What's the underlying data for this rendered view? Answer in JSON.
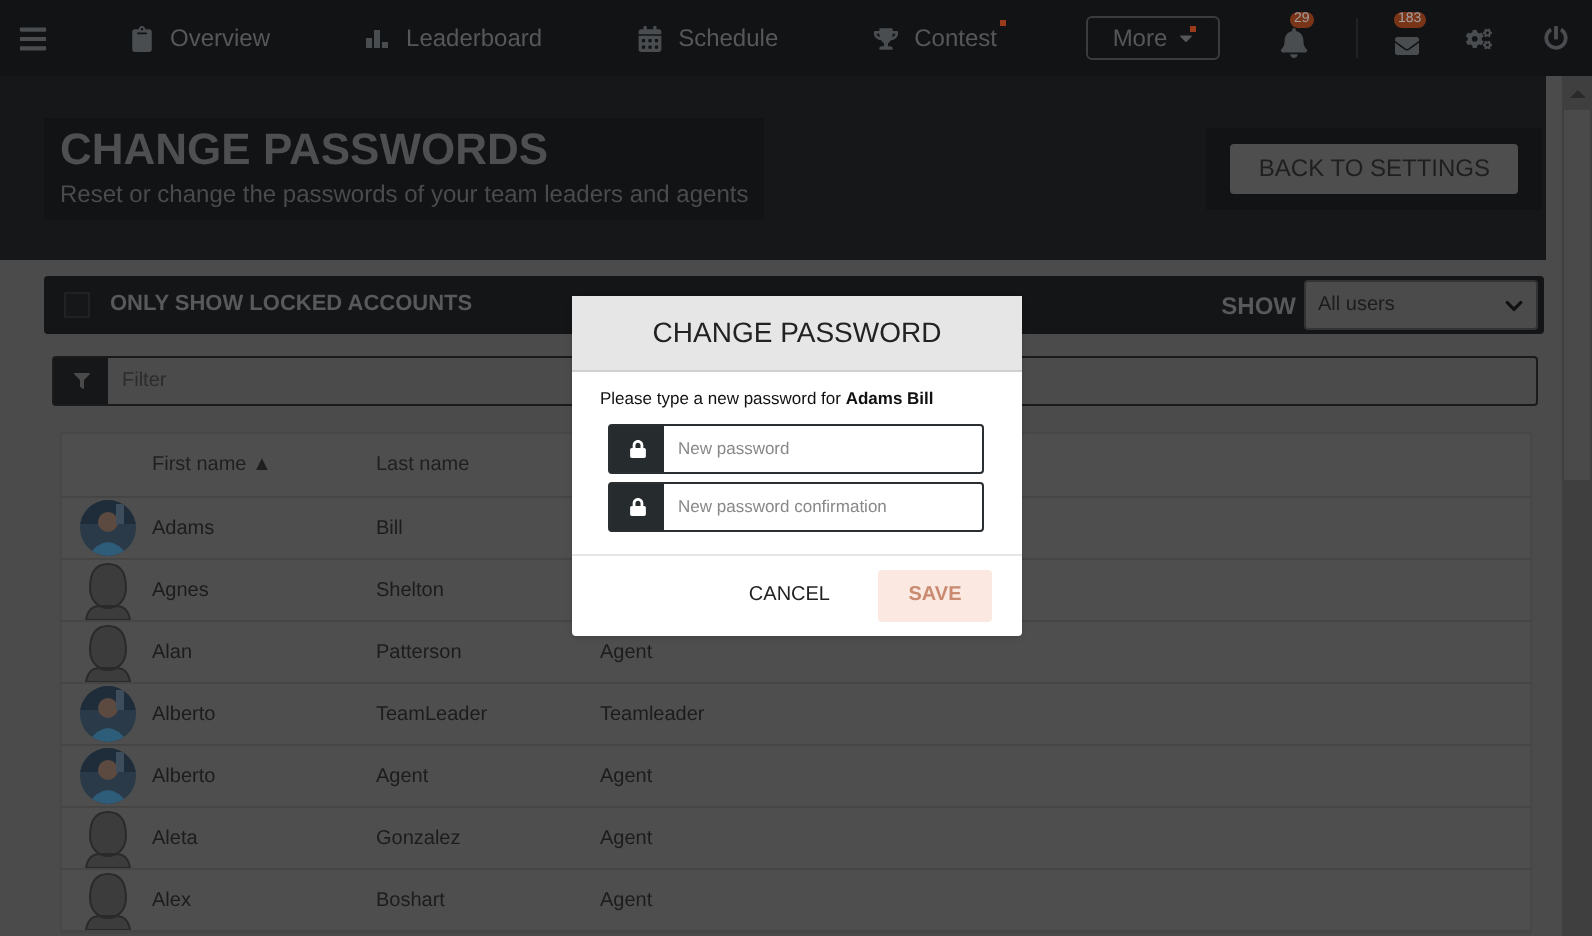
{
  "nav": {
    "items": [
      {
        "label": "Overview",
        "dot": false
      },
      {
        "label": "Leaderboard",
        "dot": false
      },
      {
        "label": "Schedule",
        "dot": false
      },
      {
        "label": "Contest",
        "dot": true
      }
    ],
    "more": {
      "label": "More",
      "dot": true
    },
    "notifications": "29",
    "messages": "183"
  },
  "header": {
    "title": "CHANGE PASSWORDS",
    "subtitle": "Reset or change the passwords of your team leaders and agents",
    "back_button": "BACK TO SETTINGS"
  },
  "toolbar": {
    "locked_only": {
      "label": "ONLY SHOW LOCKED ACCOUNTS",
      "checked": false
    },
    "show_label": "SHOW",
    "show_value": "All users"
  },
  "filter": {
    "placeholder": "Filter"
  },
  "table": {
    "columns": [
      "First name ▲",
      "Last name"
    ],
    "rows": [
      {
        "first": "Adams",
        "last": "Bill"
      },
      {
        "kind": "generic",
        "first": "Agnes",
        "last": "Shelton"
      },
      {
        "kind": "generic",
        "first": "Alan",
        "last": "Patterson",
        "role": "Agent"
      },
      {
        "first": "Alberto",
        "last": "TeamLeader",
        "role": "Teamleader"
      },
      {
        "first": "Alberto",
        "last": "Agent",
        "role": "Agent"
      },
      {
        "kind": "generic",
        "first": "Aleta",
        "last": "Gonzalez",
        "role": "Agent"
      },
      {
        "kind": "generic",
        "first": "Alex",
        "last": "Boshart",
        "role": "Agent"
      }
    ]
  },
  "dialog": {
    "title": "CHANGE PASSWORD",
    "message": "Please type a new password for **Adams Bill**",
    "fields": [
      {
        "placeholder": "New password"
      },
      {
        "placeholder": "New password confirmation"
      }
    ],
    "cancel": "CANCEL",
    "save": {
      "label": "SAVE",
      "disabled": true
    }
  }
}
